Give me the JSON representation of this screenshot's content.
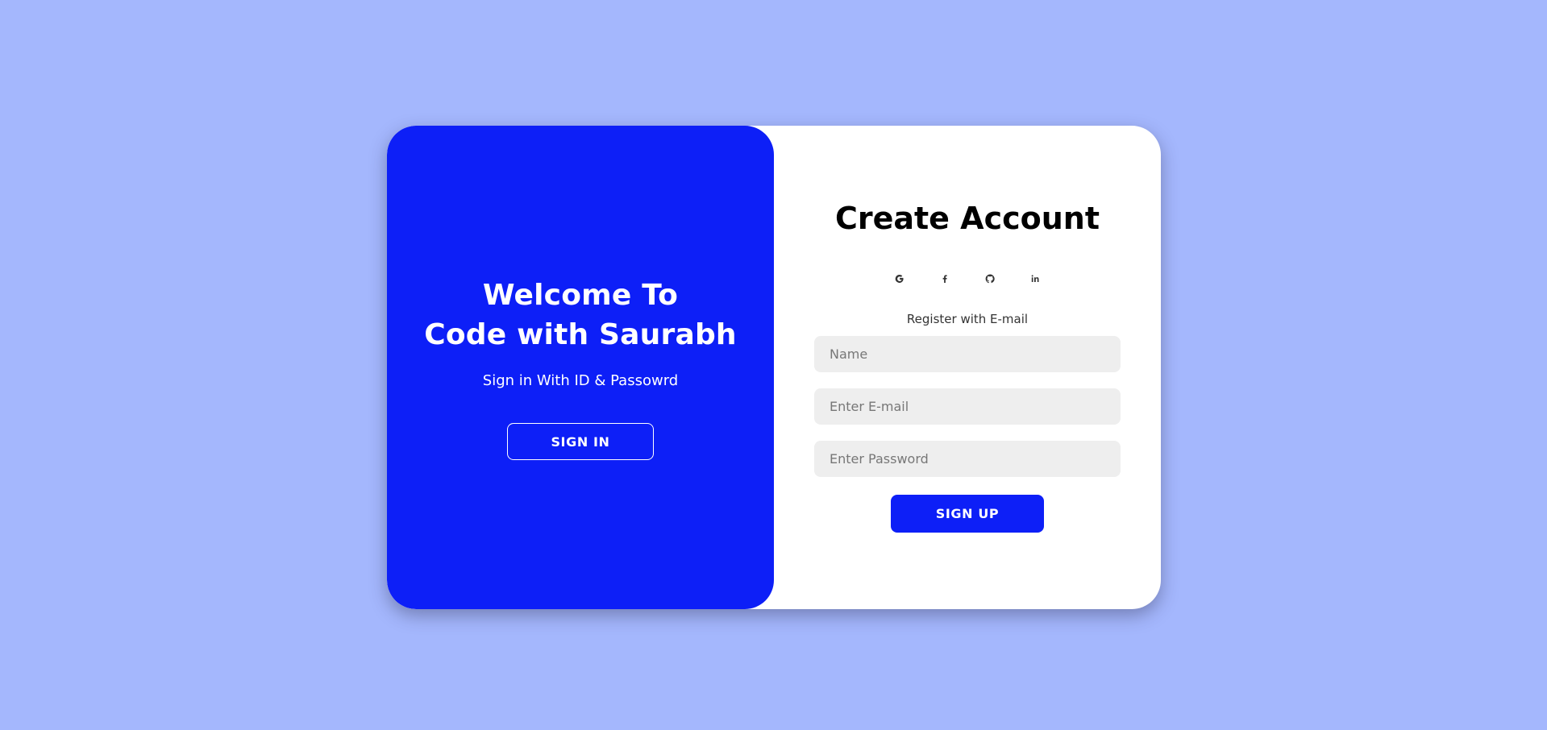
{
  "colors": {
    "page_background": "#a4b7fd",
    "accent": "#0d1ff7",
    "card_background": "#ffffff",
    "input_background": "#eeeeee"
  },
  "welcome_panel": {
    "title_line1": "Welcome To",
    "title_line2": "Code with Saurabh",
    "subtitle": "Sign in With ID & Passowrd",
    "signin_button_label": "SIGN IN"
  },
  "signup_panel": {
    "title": "Create Account",
    "social_icons": [
      "google-icon",
      "facebook-icon",
      "github-icon",
      "linkedin-icon"
    ],
    "register_text": "Register with E-mail",
    "name_field": {
      "placeholder": "Name",
      "value": ""
    },
    "email_field": {
      "placeholder": "Enter E-mail",
      "value": ""
    },
    "password_field": {
      "placeholder": "Enter Password",
      "value": ""
    },
    "signup_button_label": "SIGN UP"
  }
}
